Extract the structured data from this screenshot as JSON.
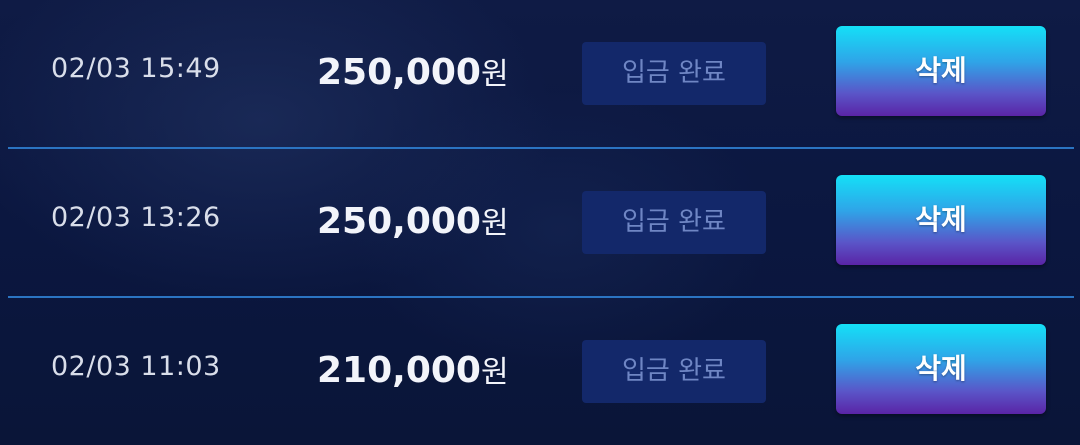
{
  "deposits": [
    {
      "time": "02/03 15:49",
      "amount": "250,000",
      "unit": "원",
      "status": "입금 완료",
      "delete_label": "삭제"
    },
    {
      "time": "02/03 13:26",
      "amount": "250,000",
      "unit": "원",
      "status": "입금 완료",
      "delete_label": "삭제"
    },
    {
      "time": "02/03 11:03",
      "amount": "210,000",
      "unit": "원",
      "status": "입금 완료",
      "delete_label": "삭제"
    }
  ],
  "colors": {
    "background": "#0b1740",
    "divider": "#2b74c2",
    "status_bg": "#13286a",
    "status_text": "#6f86c4",
    "button_top": "#14e0f7",
    "button_bottom": "#5a24a6"
  }
}
